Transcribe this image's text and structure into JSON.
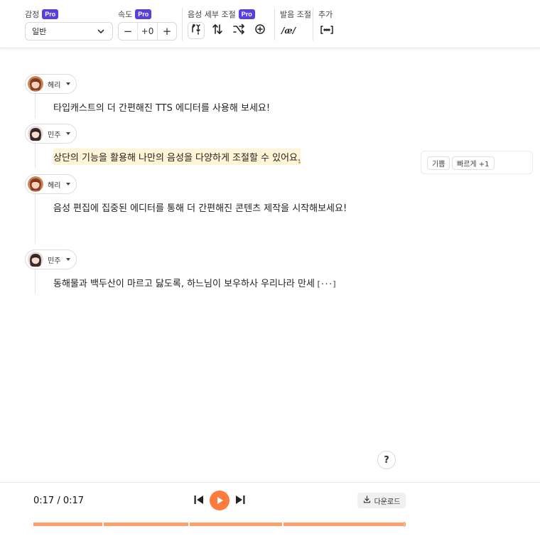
{
  "toolbar": {
    "emotion": {
      "label": "감정",
      "badge": "Pro",
      "value": "일반",
      "icon": "chevron-down-icon"
    },
    "speed": {
      "label": "속도",
      "badge": "Pro",
      "minus": "−",
      "value": "+0",
      "plus": "+"
    },
    "voice_detail": {
      "label": "음성 세부 조절",
      "badge": "Pro",
      "icons": [
        "pitch-tune-icon",
        "swap-vertical-icon",
        "shuffle-icon",
        "add-circle-icon"
      ]
    },
    "pronunciation": {
      "label": "발음 조절",
      "button": "/æ/"
    },
    "extra": {
      "label": "추가",
      "icon": "bracket-more-icon"
    }
  },
  "script": {
    "lines": [
      {
        "speaker": "헤리",
        "text": "타입캐스트의 더 간편해진 TTS 에디터를 사용해 보세요!"
      },
      {
        "speaker": "민주",
        "text": "상단의 기능을 활용해 나만의 음성을 다양하게 조절할 수 있어요.",
        "highlighted": true
      },
      {
        "speaker": "헤리",
        "text": "음성 편집에 집중된 에디터를 통해 더 간편해진 콘텐츠 제작을 시작해보세요!"
      },
      {
        "speaker": "민주",
        "text": "동해물과 백두산이 마르고 닳도록, 하느님이 보우하사 우리나라 만세",
        "more": "[···]"
      }
    ],
    "tags": [
      "기쁨",
      "빠르게 +1"
    ]
  },
  "help": {
    "label": "?"
  },
  "player": {
    "time": "0:17 / 0:17",
    "download_label": "다운로드",
    "progress": 1.0,
    "segments": 4
  },
  "colors": {
    "accent": "#ff7a3d",
    "pro_badge": "#5b3ee0",
    "highlight": "#fff5d6",
    "progress": "#ff9f6b"
  }
}
